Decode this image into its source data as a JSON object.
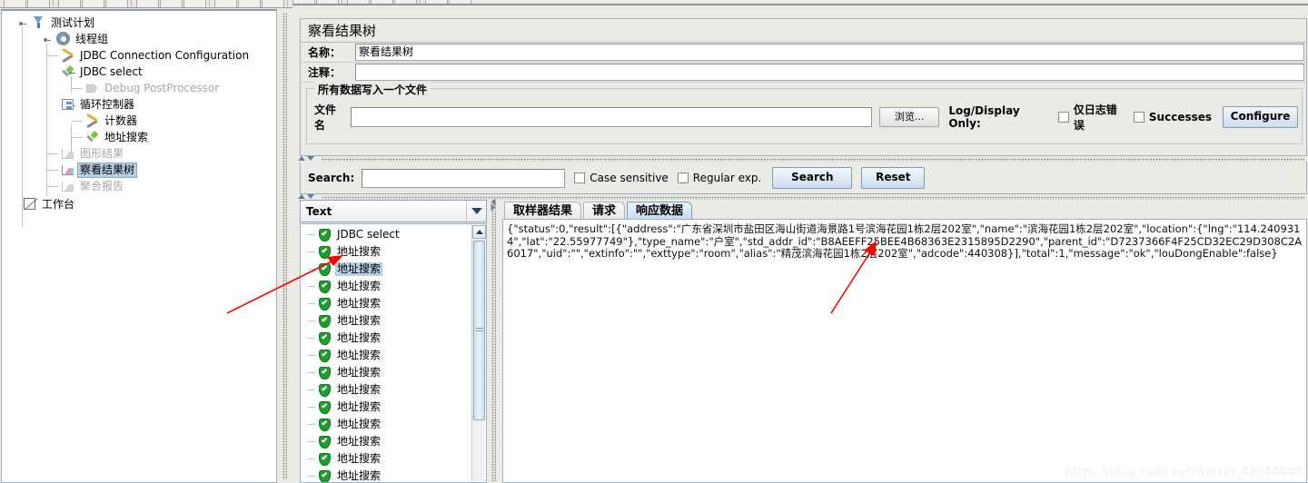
{
  "window": {
    "toolbar_visible": true
  },
  "tree": {
    "nodes": [
      {
        "label": "测试计划",
        "icon": "test-plan-funnel-icon",
        "depth": 0,
        "state": "normal"
      },
      {
        "label": "线程组",
        "icon": "thread-group-gear-icon",
        "depth": 1,
        "state": "normal"
      },
      {
        "label": "JDBC Connection Configuration",
        "icon": "config-wrench-icon",
        "depth": 2,
        "state": "normal"
      },
      {
        "label": "JDBC select",
        "icon": "sampler-pipette-icon",
        "depth": 2,
        "state": "normal"
      },
      {
        "label": "Debug PostProcessor",
        "icon": "postprocessor-arrow-icon",
        "depth": 3,
        "state": "disabled"
      },
      {
        "label": "循环控制器",
        "icon": "loop-controller-icon",
        "depth": 2,
        "state": "normal"
      },
      {
        "label": "计数器",
        "icon": "counter-wrench-icon",
        "depth": 3,
        "state": "normal"
      },
      {
        "label": "地址搜索",
        "icon": "sampler-pipette-icon",
        "depth": 3,
        "state": "normal"
      },
      {
        "label": "图形结果",
        "icon": "graph-results-icon",
        "depth": 2,
        "state": "disabled"
      },
      {
        "label": "察看结果树",
        "icon": "view-results-tree-icon",
        "depth": 2,
        "state": "selected"
      },
      {
        "label": "聚合报告",
        "icon": "aggregate-report-icon",
        "depth": 2,
        "state": "disabled"
      },
      {
        "label": "工作台",
        "icon": "workbench-icon",
        "depth": 0,
        "state": "normal"
      }
    ]
  },
  "listener": {
    "title": "察看结果树",
    "name_label": "名称：",
    "name_value": "察看结果树",
    "comment_label": "注释：",
    "comment_value": "",
    "group_legend": "所有数据写入一个文件",
    "filename_label": "文件名",
    "filename_value": "",
    "browse_button": "浏览...",
    "log_display_label": "Log/Display Only:",
    "errors_only_label": "仅日志错误",
    "errors_only_checked": false,
    "successes_label": "Successes",
    "successes_checked": false,
    "configure_button": "Configure"
  },
  "search": {
    "label": "Search:",
    "value": "",
    "case_sensitive_label": "Case sensitive",
    "case_sensitive_checked": false,
    "regex_label": "Regular exp.",
    "regex_checked": false,
    "search_button": "Search",
    "reset_button": "Reset"
  },
  "results": {
    "render_selector_value": "Text",
    "items": [
      {
        "label": "JDBC select",
        "status": "success",
        "selected": false
      },
      {
        "label": "地址搜索",
        "status": "success",
        "selected": false
      },
      {
        "label": "地址搜索",
        "status": "success",
        "selected": true
      },
      {
        "label": "地址搜索",
        "status": "success",
        "selected": false
      },
      {
        "label": "地址搜索",
        "status": "success",
        "selected": false
      },
      {
        "label": "地址搜索",
        "status": "success",
        "selected": false
      },
      {
        "label": "地址搜索",
        "status": "success",
        "selected": false
      },
      {
        "label": "地址搜索",
        "status": "success",
        "selected": false
      },
      {
        "label": "地址搜索",
        "status": "success",
        "selected": false
      },
      {
        "label": "地址搜索",
        "status": "success",
        "selected": false
      },
      {
        "label": "地址搜索",
        "status": "success",
        "selected": false
      },
      {
        "label": "地址搜索",
        "status": "success",
        "selected": false
      },
      {
        "label": "地址搜索",
        "status": "success",
        "selected": false
      },
      {
        "label": "地址搜索",
        "status": "success",
        "selected": false
      },
      {
        "label": "地址搜索",
        "status": "success",
        "selected": false
      }
    ]
  },
  "tabs": [
    {
      "label": "取样器结果",
      "active": false
    },
    {
      "label": "请求",
      "active": false
    },
    {
      "label": "响应数据",
      "active": true
    }
  ],
  "response": {
    "body": "{\"status\":0,\"result\":[{\"address\":\"广东省深圳市盐田区海山街道海景路1号滨海花园1栋2层202室\",\"name\":\"滨海花园1栋2层202室\",\"location\":{\"lng\":\"114.2409314\",\"lat\":\"22.55977749\"},\"type_name\":\"户室\",\"std_addr_id\":\"B8AEEFF25BEE4B68363E2315895D2290\",\"parent_id\":\"D7237366F4F25CD32EC29D308C2A6017\",\"uid\":\"\",\"extinfo\":\"\",\"exttype\":\"room\",\"alias\":\"精茂滨海花园1栋2层202室\",\"adcode\":440308}],\"total\":1,\"message\":\"ok\",\"louDongEnable\":false}"
  },
  "watermark": "https://blog.csdn.net/weixin_43044440",
  "colors": {
    "selection": "#b8cfe5",
    "success": "#1f9d2f",
    "panel_border": "#9fb0c2",
    "annotation": "#ff0000"
  }
}
